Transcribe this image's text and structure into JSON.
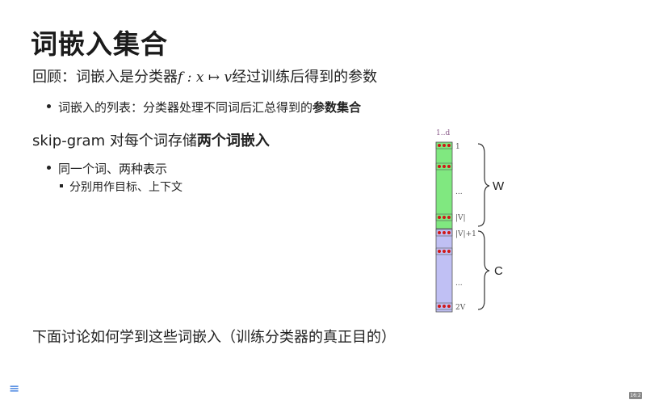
{
  "slide": {
    "title": "词嵌入集合",
    "recall_prefix": "回顾：词嵌入是分类器",
    "recall_math": "f : x ↦ v",
    "recall_suffix": "经过训练后得到的参数",
    "bullet1_prefix": "词嵌入的列表：分类器处理不同词后汇总得到的",
    "bullet1_bold": "参数集合",
    "skip_prefix": "skip-gram 对每个词存储",
    "skip_bold": "两个词嵌入",
    "bullet2": "同一个词、两种表示",
    "sub_bullet": "分别用作目标、上下文",
    "bottom": "下面讨论如何学到这些词嵌入（训练分类器的真正目的）"
  },
  "diagram": {
    "top_label": "1..d",
    "w_label": "W",
    "c_label": "C",
    "row_labels": {
      "first": "1",
      "w_dots": "...",
      "w_last": "|V|",
      "c_first": "|V|+1",
      "c_dots": "...",
      "c_last": "2V"
    },
    "colors": {
      "w_fill": "#80e880",
      "c_fill": "#c0c0f4",
      "dot": "#d01818"
    }
  },
  "nav": {
    "menu_icon": "menu-icon",
    "page_badge": "16:2"
  }
}
